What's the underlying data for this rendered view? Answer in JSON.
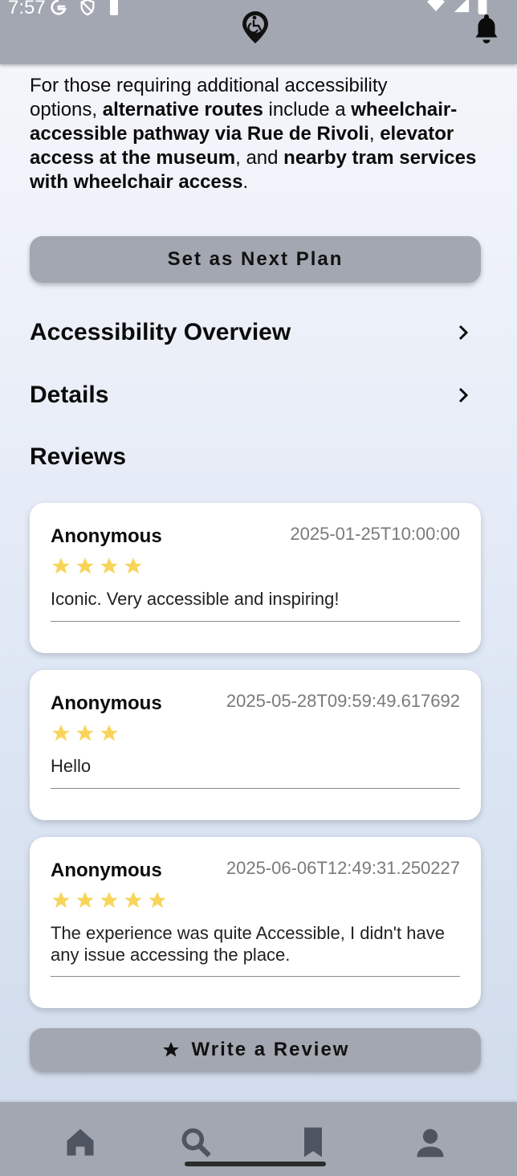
{
  "status_bar": {
    "time": "7:57"
  },
  "intro": {
    "partial_top": "For those requiring additional accessibility",
    "segments": [
      {
        "t": "options, ",
        "b": false
      },
      {
        "t": "alternative routes",
        "b": true
      },
      {
        "t": " include a ",
        "b": false
      },
      {
        "t": "wheelchair-accessible pathway via Rue de Rivoli",
        "b": true
      },
      {
        "t": ", ",
        "b": false
      },
      {
        "t": "elevator access at the museum",
        "b": true
      },
      {
        "t": ", and ",
        "b": false
      },
      {
        "t": "nearby tram services with wheelchair access",
        "b": true
      },
      {
        "t": ".",
        "b": false
      }
    ]
  },
  "actions": {
    "next_plan": "Set as Next Plan",
    "write_review": "Write a Review"
  },
  "sections": {
    "overview": "Accessibility Overview",
    "details": "Details",
    "reviews": "Reviews"
  },
  "reviews": [
    {
      "author": "Anonymous",
      "date": "2025-01-25T10:00:00",
      "stars": 4,
      "text": "Iconic. Very accessible and inspiring!"
    },
    {
      "author": "Anonymous",
      "date": "2025-05-28T09:59:49.617692",
      "stars": 3,
      "text": "Hello"
    },
    {
      "author": "Anonymous",
      "date": "2025-06-06T12:49:31.250227",
      "stars": 5,
      "text": "The experience was quite Accessible, I didn't have any issue accessing the place."
    }
  ],
  "colors": {
    "bar": "#a2a7b1",
    "star": "#f8d55a",
    "icon": "#4f5560"
  },
  "nav": {
    "items": [
      "home-icon",
      "search-icon",
      "bookmark-icon",
      "person-icon"
    ],
    "active": "search-icon"
  }
}
